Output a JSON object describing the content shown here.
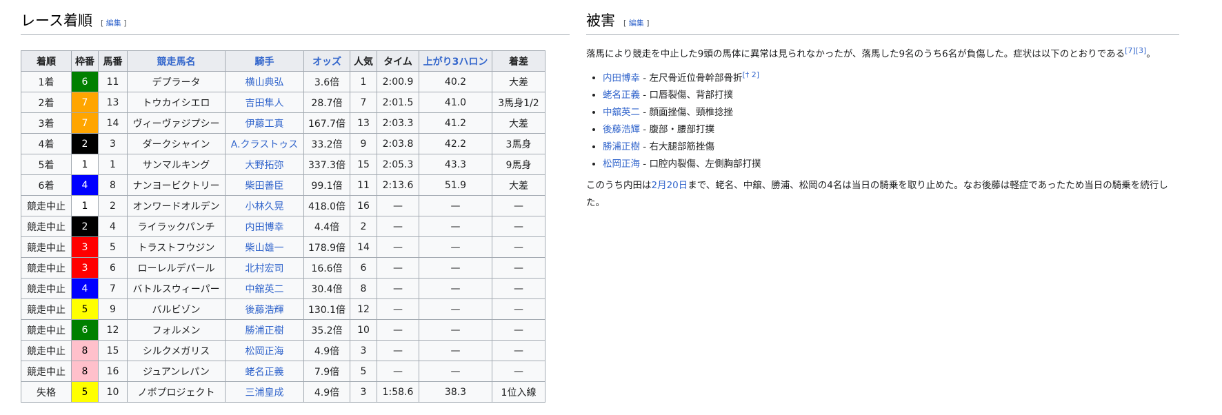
{
  "left": {
    "title": "レース着順",
    "edit_open": "[",
    "edit_label": "編集",
    "edit_close": "]",
    "headers": {
      "pos": "着順",
      "frame": "枠番",
      "num": "馬番",
      "horse": "競走馬名",
      "jockey": "騎手",
      "odds": "オッズ",
      "pop": "人気",
      "time": "タイム",
      "up": "上がり3ハロン",
      "margin": "着差"
    },
    "rows": [
      {
        "pos": "1着",
        "frame": "6",
        "num": "11",
        "horse": "デプラータ",
        "jockey": "横山典弘",
        "odds": "3.6倍",
        "pop": "1",
        "time": "2:00.9",
        "up": "40.2",
        "margin": "大差"
      },
      {
        "pos": "2着",
        "frame": "7",
        "num": "13",
        "horse": "トウカイシエロ",
        "jockey": "吉田隼人",
        "odds": "28.7倍",
        "pop": "7",
        "time": "2:01.5",
        "up": "41.0",
        "margin": "3馬身1/2"
      },
      {
        "pos": "3着",
        "frame": "7",
        "num": "14",
        "horse": "ヴィーヴァジプシー",
        "jockey": "伊藤工真",
        "odds": "167.7倍",
        "pop": "13",
        "time": "2:03.3",
        "up": "41.2",
        "margin": "大差"
      },
      {
        "pos": "4着",
        "frame": "2",
        "num": "3",
        "horse": "ダークシャイン",
        "jockey": "A.クラストゥス",
        "odds": "33.2倍",
        "pop": "9",
        "time": "2:03.8",
        "up": "42.2",
        "margin": "3馬身"
      },
      {
        "pos": "5着",
        "frame": "1",
        "num": "1",
        "horse": "サンマルキング",
        "jockey": "大野拓弥",
        "odds": "337.3倍",
        "pop": "15",
        "time": "2:05.3",
        "up": "43.3",
        "margin": "9馬身"
      },
      {
        "pos": "6着",
        "frame": "4",
        "num": "8",
        "horse": "ナンヨービクトリー",
        "jockey": "柴田善臣",
        "odds": "99.1倍",
        "pop": "11",
        "time": "2:13.6",
        "up": "51.9",
        "margin": "大差"
      },
      {
        "pos": "競走中止",
        "frame": "1",
        "num": "2",
        "horse": "オンワードオルデン",
        "jockey": "小林久晃",
        "odds": "418.0倍",
        "pop": "16",
        "time": "—",
        "up": "—",
        "margin": "—"
      },
      {
        "pos": "競走中止",
        "frame": "2",
        "num": "4",
        "horse": "ライラックパンチ",
        "jockey": "内田博幸",
        "odds": "4.4倍",
        "pop": "2",
        "time": "—",
        "up": "—",
        "margin": "—"
      },
      {
        "pos": "競走中止",
        "frame": "3",
        "num": "5",
        "horse": "トラストフウジン",
        "jockey": "柴山雄一",
        "odds": "178.9倍",
        "pop": "14",
        "time": "—",
        "up": "—",
        "margin": "—"
      },
      {
        "pos": "競走中止",
        "frame": "3",
        "num": "6",
        "horse": "ローレルデパール",
        "jockey": "北村宏司",
        "odds": "16.6倍",
        "pop": "6",
        "time": "—",
        "up": "—",
        "margin": "—"
      },
      {
        "pos": "競走中止",
        "frame": "4",
        "num": "7",
        "horse": "バトルスウィーパー",
        "jockey": "中舘英二",
        "odds": "30.4倍",
        "pop": "8",
        "time": "—",
        "up": "—",
        "margin": "—"
      },
      {
        "pos": "競走中止",
        "frame": "5",
        "num": "9",
        "horse": "バルビゾン",
        "jockey": "後藤浩輝",
        "odds": "130.1倍",
        "pop": "12",
        "time": "—",
        "up": "—",
        "margin": "—"
      },
      {
        "pos": "競走中止",
        "frame": "6",
        "num": "12",
        "horse": "フォルメン",
        "jockey": "勝浦正樹",
        "odds": "35.2倍",
        "pop": "10",
        "time": "—",
        "up": "—",
        "margin": "—"
      },
      {
        "pos": "競走中止",
        "frame": "8",
        "num": "15",
        "horse": "シルクメガリス",
        "jockey": "松岡正海",
        "odds": "4.9倍",
        "pop": "3",
        "time": "—",
        "up": "—",
        "margin": "—"
      },
      {
        "pos": "競走中止",
        "frame": "8",
        "num": "16",
        "horse": "ジュアンレパン",
        "jockey": "蛯名正義",
        "odds": "7.9倍",
        "pop": "5",
        "time": "—",
        "up": "—",
        "margin": "—"
      },
      {
        "pos": "失格",
        "frame": "5",
        "num": "10",
        "horse": "ノボプロジェクト",
        "jockey": "三浦皇成",
        "odds": "4.9倍",
        "pop": "3",
        "time": "1:58.6",
        "up": "38.3",
        "margin": "1位入線"
      }
    ],
    "frame_colors": {
      "1": {
        "bg": "#ffffff",
        "fg": "#000000"
      },
      "2": {
        "bg": "#000000",
        "fg": "#ffffff"
      },
      "3": {
        "bg": "#ff0000",
        "fg": "#ffffff"
      },
      "4": {
        "bg": "#0000ff",
        "fg": "#ffffff"
      },
      "5": {
        "bg": "#ffff00",
        "fg": "#000000"
      },
      "6": {
        "bg": "#008000",
        "fg": "#ffffff"
      },
      "7": {
        "bg": "#ffa500",
        "fg": "#ffffff"
      },
      "8": {
        "bg": "#ffc0cb",
        "fg": "#000000"
      }
    }
  },
  "right": {
    "title": "被害",
    "edit_open": "[",
    "edit_label": "編集",
    "edit_close": "]",
    "intro": "落馬により競走を中止した9頭の馬体に異常は見られなかったが、落馬した9名のうち6名が負傷した。症状は以下のとおりである",
    "intro_refs": "[7][3]",
    "intro_end": "。",
    "injuries": [
      {
        "name": "内田博幸",
        "detail": " - 左尺骨近位骨幹部骨折",
        "ref": "[† 2]"
      },
      {
        "name": "蛯名正義",
        "detail": " - 口唇裂傷、背部打撲",
        "ref": ""
      },
      {
        "name": "中舘英二",
        "detail": " - 顔面挫傷、頸椎捻挫",
        "ref": ""
      },
      {
        "name": "後藤浩輝",
        "detail": " - 腹部・腰部打撲",
        "ref": ""
      },
      {
        "name": "勝浦正樹",
        "detail": " - 右大腿部筋挫傷",
        "ref": ""
      },
      {
        "name": "松岡正海",
        "detail": " - 口腔内裂傷、左側胸部打撲",
        "ref": ""
      }
    ],
    "outro_before": "このうち内田は",
    "outro_link": "2月20日",
    "outro_after": "まで、蛯名、中舘、勝浦、松岡の4名は当日の騎乗を取り止めた。なお後藤は軽症であったため当日の騎乗を続行した。"
  }
}
